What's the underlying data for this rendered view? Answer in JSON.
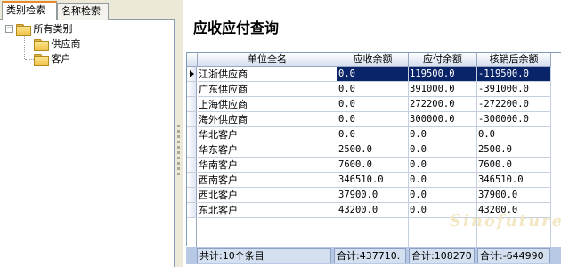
{
  "tabs": [
    {
      "label": "类别检索"
    },
    {
      "label": "名称检索"
    }
  ],
  "tree": {
    "root": "所有类别",
    "expander": "−",
    "children": [
      "供应商",
      "客户"
    ]
  },
  "main": {
    "title": "应收应付查询",
    "columns": [
      "单位全名",
      "应收余额",
      "应付余额",
      "核销后余额"
    ],
    "rows": [
      [
        "江浙供应商",
        "0.0",
        "119500.0",
        "-119500.0"
      ],
      [
        "广东供应商",
        "0.0",
        "391000.0",
        "-391000.0"
      ],
      [
        "上海供应商",
        "0.0",
        "272200.0",
        "-272200.0"
      ],
      [
        "海外供应商",
        "0.0",
        "300000.0",
        "-300000.0"
      ],
      [
        "华北客户",
        "0.0",
        "0.0",
        "0.0"
      ],
      [
        "华东客户",
        "2500.0",
        "0.0",
        "2500.0"
      ],
      [
        "华南客户",
        "7600.0",
        "0.0",
        "7600.0"
      ],
      [
        "西南客户",
        "346510.0",
        "0.0",
        "346510.0"
      ],
      [
        "西北客户",
        "37900.0",
        "0.0",
        "37900.0"
      ],
      [
        "东北客户",
        "43200.0",
        "0.0",
        "43200.0"
      ]
    ],
    "selected_row": 0
  },
  "footer": {
    "count": "共计:10个条目",
    "sum_receivable": "合计:437710.",
    "sum_payable": "合计:108270",
    "sum_balance": "合计:-644990"
  },
  "watermark": "Sinofuture"
}
